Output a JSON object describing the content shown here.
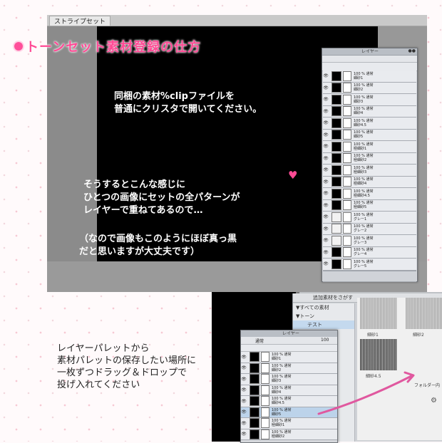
{
  "title": "トーンセット素材登録の仕方",
  "screen1": {
    "tab_label": "ストライプセット",
    "text_block1": [
      "同梱の素材%clipファイルを",
      "普通にクリスタで開いてください。"
    ],
    "text_block2": [
      "そうするとこんな感じに",
      "ひとつの画像にセットの全パターンが",
      "レイヤーで重ねてあるので…"
    ],
    "text_block3": [
      "（なので画像もこのようにほぼ真っ黒",
      "だと思いますが大丈夫です）"
    ],
    "panel_title": "レイヤー",
    "layers": [
      {
        "mode": "100 % 通常",
        "name": "細砂1",
        "dark": true
      },
      {
        "mode": "100 % 通常",
        "name": "細砂2",
        "dark": true
      },
      {
        "mode": "100 % 通常",
        "name": "細砂3",
        "dark": true
      },
      {
        "mode": "100 % 通常",
        "name": "細砂4",
        "dark": true
      },
      {
        "mode": "100 % 通常",
        "name": "細砂4.5",
        "dark": true
      },
      {
        "mode": "100 % 通常",
        "name": "細砂5",
        "dark": true
      },
      {
        "mode": "100 % 通常",
        "name": "極細砂1",
        "dark": true
      },
      {
        "mode": "100 % 通常",
        "name": "極細砂2",
        "dark": true
      },
      {
        "mode": "100 % 通常",
        "name": "極細砂3",
        "dark": true
      },
      {
        "mode": "100 % 通常",
        "name": "極細砂4",
        "dark": true
      },
      {
        "mode": "100 % 通常",
        "name": "極細砂4.5",
        "dark": true
      },
      {
        "mode": "100 % 通常",
        "name": "極細砂5",
        "dark": true
      },
      {
        "mode": "100 % 通常",
        "name": "グレー1",
        "dark": false
      },
      {
        "mode": "100 % 通常",
        "name": "グレー2",
        "dark": false
      },
      {
        "mode": "100 % 通常",
        "name": "グレー3",
        "dark": false
      },
      {
        "mode": "100 % 通常",
        "name": "グレー4",
        "dark": true
      },
      {
        "mode": "100 % 通常",
        "name": "グレー5",
        "dark": true
      },
      {
        "mode": "",
        "name": "用紙",
        "dark": false
      }
    ]
  },
  "screen2": {
    "instruction": [
      "レイヤーパレットから",
      "素材パレットの保存したい場所に",
      "一枚ずつドラッグ＆ドロップで",
      "投げ入れてください"
    ],
    "material_search": "追加素材をさがす",
    "tree": [
      "▼すべての素材",
      "▼トーン",
      "テスト"
    ],
    "tex_labels": [
      "細砂1",
      "細砂2",
      "細砂4.5"
    ],
    "folder_label": "フォルダー内",
    "panel_title": "レイヤー",
    "blend_mode": "通常",
    "opacity": "100",
    "layers": [
      {
        "mode": "100 % 通常",
        "name": "細砂1"
      },
      {
        "mode": "100 % 通常",
        "name": "細砂2"
      },
      {
        "mode": "100 % 通常",
        "name": "細砂3"
      },
      {
        "mode": "100 % 通常",
        "name": "細砂4"
      },
      {
        "mode": "100 % 通常",
        "name": "細砂4.5"
      },
      {
        "mode": "100 % 通常",
        "name": "細砂5"
      },
      {
        "mode": "100 % 通常",
        "name": "極細砂1"
      },
      {
        "mode": "100 % 通常",
        "name": "極細砂2"
      }
    ],
    "arrow_color": "#e0589f"
  },
  "colors": {
    "accent": "#ff4a95",
    "arrow": "#e0589f"
  }
}
